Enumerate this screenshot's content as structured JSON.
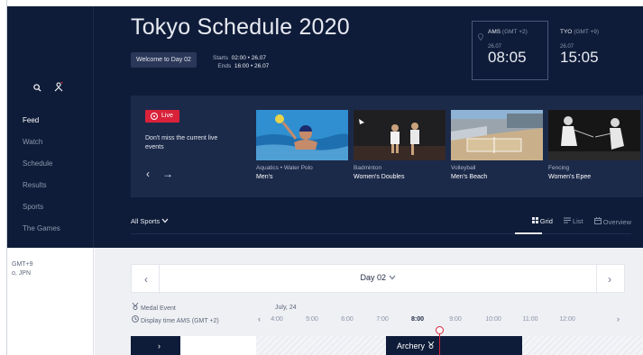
{
  "app": {
    "title": "Tokyo Schedule 2020"
  },
  "header": {
    "welcome": "Welcome to Day 02",
    "starts_label": "Starts",
    "starts_value": "02:00 • 26.07",
    "ends_label": "Ends",
    "ends_value": "16:00 • 26.07"
  },
  "clocks": {
    "ams": {
      "code": "AMS",
      "offset": "(GMT +2)",
      "date": "26.07",
      "time": "08:05"
    },
    "tyo": {
      "code": "TYO",
      "offset": "(GMT +9)",
      "date": "26.07",
      "time": "15:05"
    }
  },
  "sidebar": {
    "items": [
      {
        "label": "Feed",
        "active": true
      },
      {
        "label": "Watch"
      },
      {
        "label": "Schedule"
      },
      {
        "label": "Results"
      },
      {
        "label": "Sports"
      },
      {
        "label": "The Games"
      }
    ],
    "tz_line1": "GMT+9",
    "tz_line2": "o, JPN"
  },
  "live": {
    "button_label": "Live",
    "description": "Don't miss the current live events"
  },
  "live_cards": [
    {
      "sport": "Aquatics • Water Polo",
      "event": "Men's"
    },
    {
      "sport": "Badminton",
      "event": "Women's Doubles"
    },
    {
      "sport": "Volleyball",
      "event": "Men's Beach"
    },
    {
      "sport": "Fencing",
      "event": "Women's Epee"
    }
  ],
  "filters": {
    "all_sports": "All Sports",
    "grid": "Grid",
    "list": "List",
    "overview": "Overview"
  },
  "schedule": {
    "day_label": "Day 02",
    "medal_event": "Medal Event",
    "display_time": "Display time AMS (GMT +2)",
    "month": "July, 24",
    "times": [
      "4:00",
      "5:00",
      "6:00",
      "7:00",
      "8:00",
      "9:00",
      "10:00",
      "11:00",
      "12:00"
    ],
    "current_time": "8:00",
    "event_block": "Archery"
  },
  "colors": {
    "navy": "#0f1c39",
    "panel": "#1c2a4a",
    "live_red": "#d9223a"
  }
}
